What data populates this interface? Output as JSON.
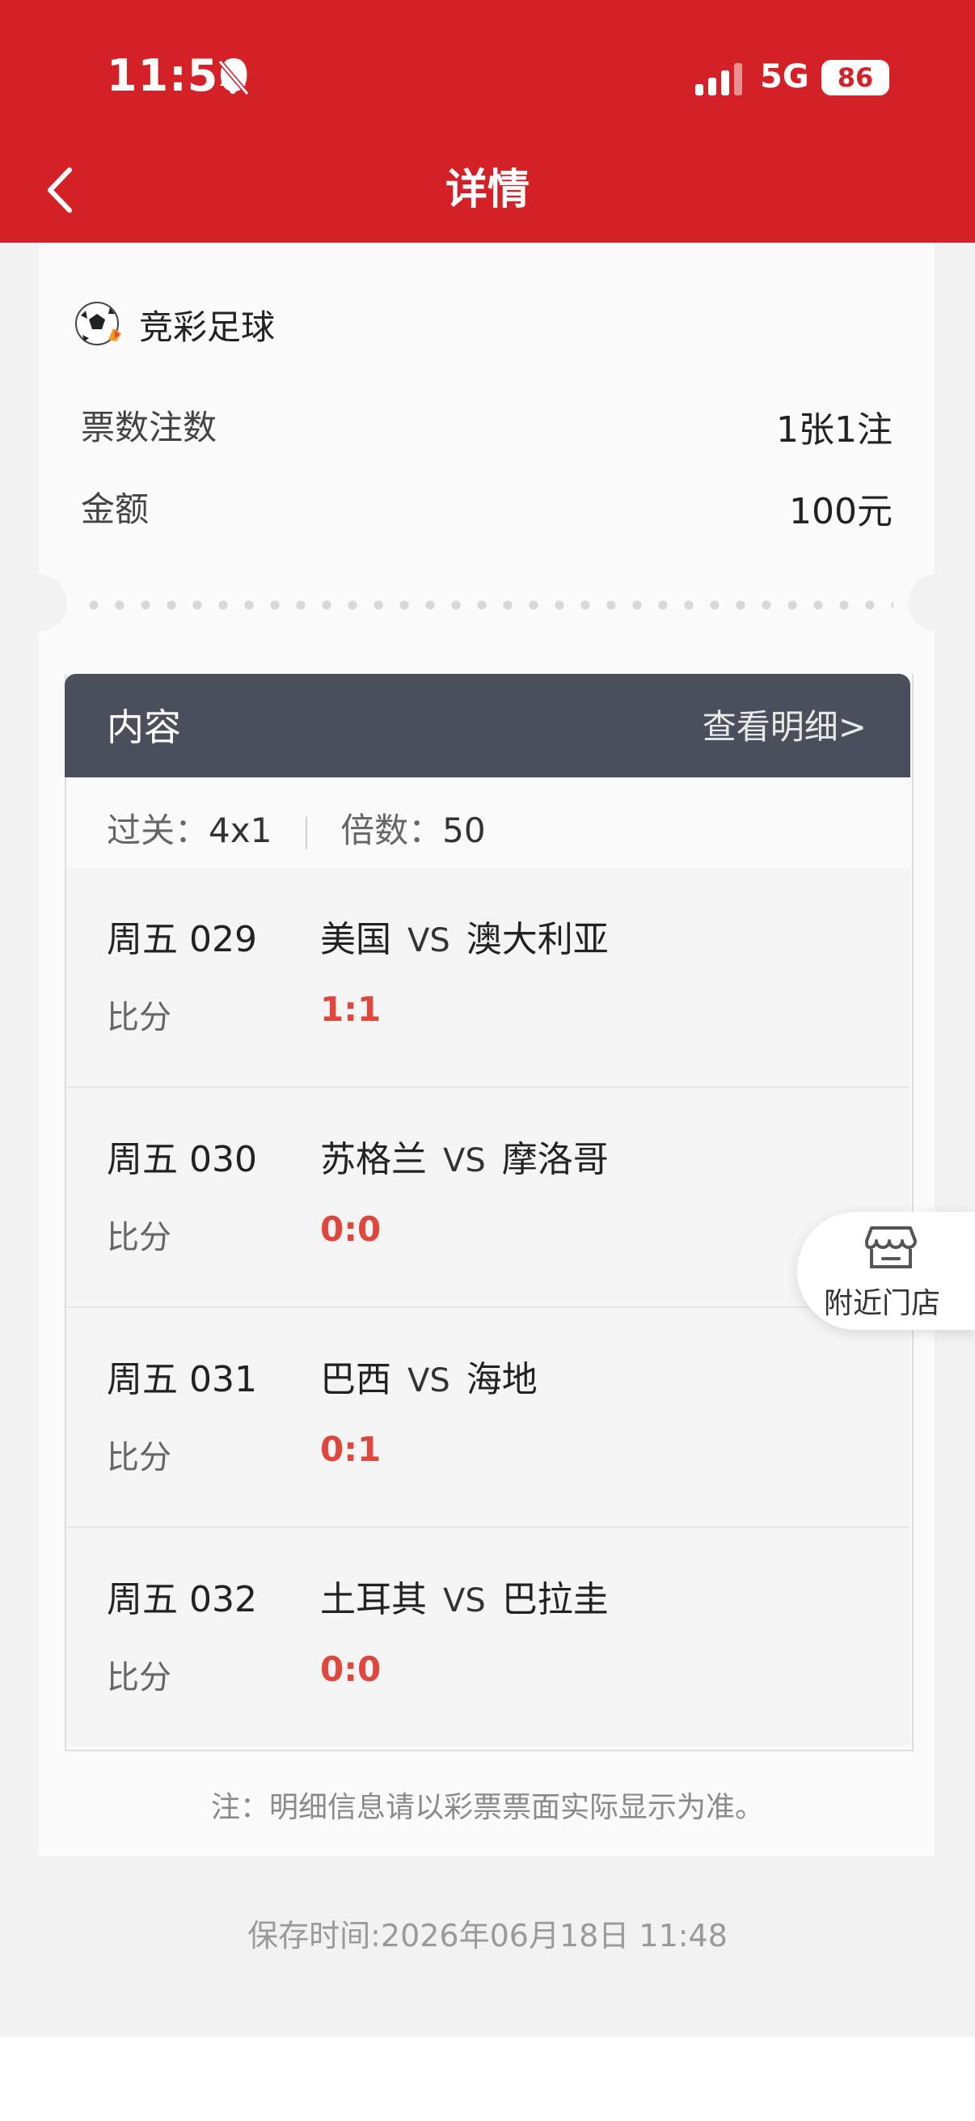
{
  "status_bar": {
    "time": "11:50",
    "network": "5G",
    "battery": "86"
  },
  "header": {
    "title": "详情"
  },
  "ticket": {
    "game_name": "竞彩足球",
    "rows": [
      {
        "label": "票数注数",
        "value": "1张1注"
      },
      {
        "label": "金额",
        "value": "100元"
      }
    ]
  },
  "content": {
    "title": "内容",
    "detail_link": "查看明细>",
    "pass_label": "过关",
    "pass_value": "4x1",
    "multiple_label": "倍数",
    "multiple_value": "50",
    "matches": [
      {
        "no": "周五 029",
        "home": "美国",
        "vs": "VS",
        "away": "澳大利亚",
        "score_label": "比分",
        "score": "1:1"
      },
      {
        "no": "周五 030",
        "home": "苏格兰",
        "vs": "VS",
        "away": "摩洛哥",
        "score_label": "比分",
        "score": "0:0"
      },
      {
        "no": "周五 031",
        "home": "巴西",
        "vs": "VS",
        "away": "海地",
        "score_label": "比分",
        "score": "0:1"
      },
      {
        "no": "周五 032",
        "home": "土耳其",
        "vs": "VS",
        "away": "巴拉圭",
        "score_label": "比分",
        "score": "0:0"
      }
    ],
    "note": "注：明细信息请以彩票票面实际显示为准。"
  },
  "save_time": "保存时间:2026年06月18日 11:48",
  "nearby_store": {
    "label": "附近门店"
  },
  "colors": {
    "brand_red": "#d42127",
    "score_red": "#e1463c",
    "table_header": "#4a4f5b"
  },
  "icons": [
    "bell-muted-icon",
    "signal-icon",
    "back-chevron-icon",
    "soccer-ball-icon",
    "store-icon"
  ]
}
